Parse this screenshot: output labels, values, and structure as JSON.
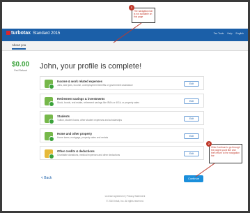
{
  "header": {
    "logo_text": "turbotax",
    "edition": "Standard 2015",
    "links": [
      "Tax Tools",
      "Help",
      "English"
    ]
  },
  "subnav": {
    "tab_label": "About you"
  },
  "refund": {
    "amount": "$0.00",
    "label": "Fed Refund"
  },
  "main": {
    "title": "John, your profile is complete!",
    "cards": [
      {
        "title": "Income & work related expenses",
        "desc": "Jobs, side jobs, income, unemployment benefits or government assistance",
        "edit_label": "Edit"
      },
      {
        "title": "Retirement savings & investments",
        "desc": "Stock, bonds, real estate, retirement savings like IRA's or 401k, or property sales",
        "edit_label": "Edit"
      },
      {
        "title": "Students",
        "desc": "Tuition, student loans, other student expenses and scholarships",
        "edit_label": "Edit"
      },
      {
        "title": "Home and other property",
        "desc": "Home taxes, mortgage, property sales and rentals",
        "edit_label": "Edit"
      },
      {
        "title": "Other credits & deductions",
        "desc": "Charitable donations, medical expenses and other deductions",
        "edit_label": "Edit"
      }
    ]
  },
  "nav": {
    "back_label": "< Back",
    "continue_label": "Continue"
  },
  "footer": {
    "links": "License Agreement  |  Privacy Statement",
    "copyright": "© 2015 Intuit, Inc. All rights reserved."
  },
  "callouts": [
    {
      "num": "1",
      "text": "The navigation bar is not available on this page"
    },
    {
      "num": "2",
      "text": "Click Continue to go through the pages you'd like and then return to the navigation bar"
    }
  ],
  "colors": {
    "brand_blue": "#1b5fa8",
    "accent_green": "#3aa23a",
    "callout_red": "#c0392b"
  }
}
